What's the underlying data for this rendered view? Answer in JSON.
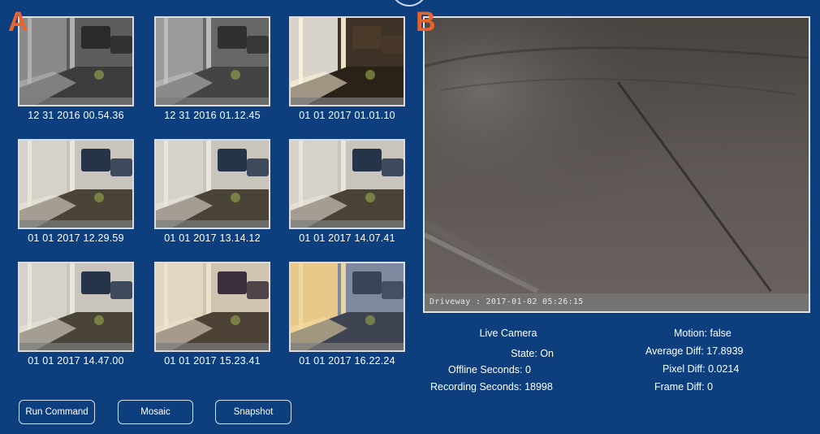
{
  "panels": {
    "left_letter": "A",
    "right_letter": "B"
  },
  "snapshots": [
    {
      "caption": "12 31 2016 00.54.36",
      "scene": "night-gray"
    },
    {
      "caption": "12 31 2016 01.12.45",
      "scene": "night-gray-2"
    },
    {
      "caption": "01 01 2017 01.01.10",
      "scene": "night-lit"
    },
    {
      "caption": "01 01 2017 12.29.59",
      "scene": "day"
    },
    {
      "caption": "01 01 2017 13.14.12",
      "scene": "day"
    },
    {
      "caption": "01 01 2017 14.07.41",
      "scene": "day"
    },
    {
      "caption": "01 01 2017 14.47.00",
      "scene": "day"
    },
    {
      "caption": "01 01 2017 15.23.41",
      "scene": "day-warm"
    },
    {
      "caption": "01 01 2017 16.22.24",
      "scene": "dusk"
    }
  ],
  "live_camera": {
    "title": "Live Camera",
    "overlay_text": "Driveway : 2017-01-02 05:26:15",
    "state_label": "State:",
    "state_value": "On",
    "offline_label": "Offline Seconds:",
    "offline_value": "0",
    "recording_label": "Recording Seconds:",
    "recording_value": "18998"
  },
  "motion": {
    "motion_label": "Motion:",
    "motion_value": "false",
    "avg_label": "Average Diff:",
    "avg_value": "17.8939",
    "pixel_label": "Pixel Diff:",
    "pixel_value": "0.0214",
    "frame_label": "Frame Diff:",
    "frame_value": "0"
  },
  "buttons": {
    "run_command": "Run Command",
    "mosaic": "Mosaic",
    "snapshot": "Snapshot"
  },
  "colors": {
    "background": "#0d3e7e",
    "accent": "#e8642e",
    "text": "#ffffff"
  }
}
